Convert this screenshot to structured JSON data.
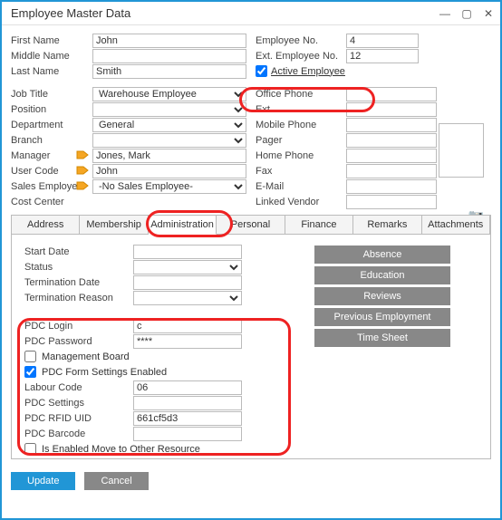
{
  "window": {
    "title": "Employee Master Data"
  },
  "labels": {
    "firstName": "First Name",
    "middleName": "Middle Name",
    "lastName": "Last Name",
    "jobTitle": "Job Title",
    "position": "Position",
    "department": "Department",
    "branch": "Branch",
    "manager": "Manager",
    "userCode": "User Code",
    "salesEmployee": "Sales Employee",
    "costCenter": "Cost Center",
    "employeeNo": "Employee No.",
    "extEmployeeNo": "Ext. Employee No.",
    "activeEmployee": "Active Employee",
    "officePhone": "Office Phone",
    "ext": "Ext.",
    "mobilePhone": "Mobile Phone",
    "pager": "Pager",
    "homePhone": "Home Phone",
    "fax": "Fax",
    "email": "E-Mail",
    "linkedVendor": "Linked Vendor"
  },
  "values": {
    "firstName": "John",
    "middleName": "",
    "lastName": "Smith",
    "jobTitle": "Warehouse Employee",
    "position": "",
    "department": "General",
    "branch": "",
    "manager": "Jones, Mark",
    "userCode": "John",
    "salesEmployee": "-No Sales Employee-",
    "costCenter": "",
    "employeeNo": "4",
    "extEmployeeNo": "12",
    "activeEmployee": true,
    "officePhone": "",
    "ext": "",
    "mobilePhone": "",
    "pager": "",
    "homePhone": "",
    "fax": "",
    "email": "",
    "linkedVendor": ""
  },
  "tabs": [
    "Address",
    "Membership",
    "Administration",
    "Personal",
    "Finance",
    "Remarks",
    "Attachments"
  ],
  "activeTab": "Administration",
  "admin": {
    "labels": {
      "startDate": "Start Date",
      "status": "Status",
      "terminationDate": "Termination Date",
      "terminationReason": "Termination Reason",
      "pdcLogin": "PDC Login",
      "pdcPassword": "PDC Password",
      "managementBoard": "Management Board",
      "pdcFormSettings": "PDC Form Settings Enabled",
      "labourCode": "Labour Code",
      "pdcSettings": "PDC Settings",
      "pdcRfidUid": "PDC RFID UID",
      "pdcBarcode": "PDC Barcode",
      "isEnabledMove": "Is Enabled Move to Other Resource"
    },
    "values": {
      "startDate": "",
      "status": "",
      "terminationDate": "",
      "terminationReason": "",
      "pdcLogin": "c",
      "pdcPassword": "****",
      "managementBoard": false,
      "pdcFormSettings": true,
      "labourCode": "06",
      "pdcSettings": "",
      "pdcRfidUid": "661cf5d3",
      "pdcBarcode": "",
      "isEnabledMove": false
    },
    "buttons": [
      "Absence",
      "Education",
      "Reviews",
      "Previous Employment",
      "Time Sheet"
    ]
  },
  "footer": {
    "update": "Update",
    "cancel": "Cancel"
  }
}
